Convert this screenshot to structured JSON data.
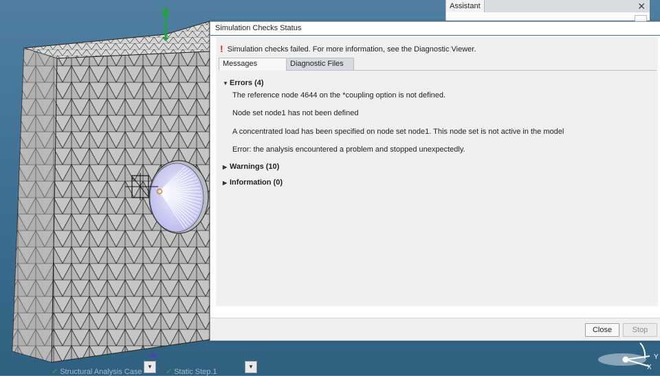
{
  "assistant": {
    "tab_label": "Assistant",
    "close_glyph": "✕"
  },
  "dialog": {
    "title": "Simulation Checks Status",
    "status_message": "Simulation checks failed. For more information, see the Diagnostic Viewer.",
    "tabs": [
      {
        "label": "Messages",
        "active": true
      },
      {
        "label": "Diagnostic Files",
        "active": false
      }
    ],
    "groups": {
      "errors": {
        "label": "Errors (4)",
        "expanded": true,
        "items": [
          "The reference node 4644 on the *coupling option is not defined.",
          "Node set node1 has not been defined",
          "A concentrated load has been specified on node set node1.  This node set is not active in the model",
          "Error: the analysis encountered a problem and stopped unexpectedly."
        ]
      },
      "warnings": {
        "label": "Warnings (10)",
        "expanded": false
      },
      "information": {
        "label": "Information (0)",
        "expanded": false
      }
    },
    "buttons": {
      "close": "Close",
      "stop": "Stop"
    }
  },
  "tree": {
    "case_label": "Structural Analysis Case",
    "step_label": "Static Step.1"
  },
  "compass": {
    "y_label": "Y",
    "x_label": "X"
  },
  "colors": {
    "error": "#d62a1e",
    "accent": "#3b6e93",
    "check": "#37b34a"
  }
}
